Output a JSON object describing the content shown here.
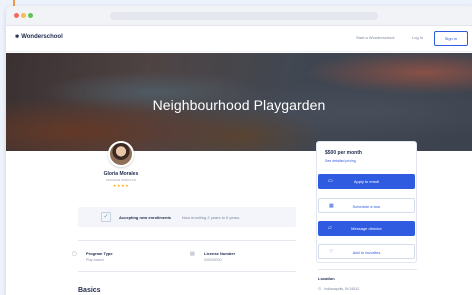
{
  "nav": {
    "brand": "Wonderschool",
    "start_link": "Start a Wonderschool",
    "login_link": "Log In",
    "signin_button": "Sign In"
  },
  "hero": {
    "title": "Neighbourhood Playgarden"
  },
  "profile": {
    "name": "Gloria Morales",
    "role": "PROGRAM DIRECTOR",
    "stars": "★★★★"
  },
  "enrollment": {
    "label": "Accepting new enrollments",
    "detail": "Now enrolling 2 years to 6 years."
  },
  "info": {
    "program_type_title": "Program Type",
    "program_type_value": "Play-based",
    "license_title": "License Number",
    "license_value": "000000000"
  },
  "sections": {
    "basics": "Basics"
  },
  "card": {
    "price": "$500 per month",
    "pricing_link": "See detailed pricing",
    "apply": "Apply to enroll",
    "tour": "Schedule a tour",
    "message": "Message director",
    "favorites": "Add to favorites"
  },
  "location": {
    "label": "Location",
    "value": "Indianapolis, IN 24512"
  },
  "colors": {
    "accent": "#2f5be0",
    "text_dark": "#1f2b4d",
    "star": "#f2b01e"
  },
  "icons": [
    "calendar-icon",
    "message-icon",
    "heart-icon",
    "apply-icon",
    "program-type-icon",
    "license-icon",
    "location-pin-icon",
    "check-icon",
    "brand-icon"
  ]
}
